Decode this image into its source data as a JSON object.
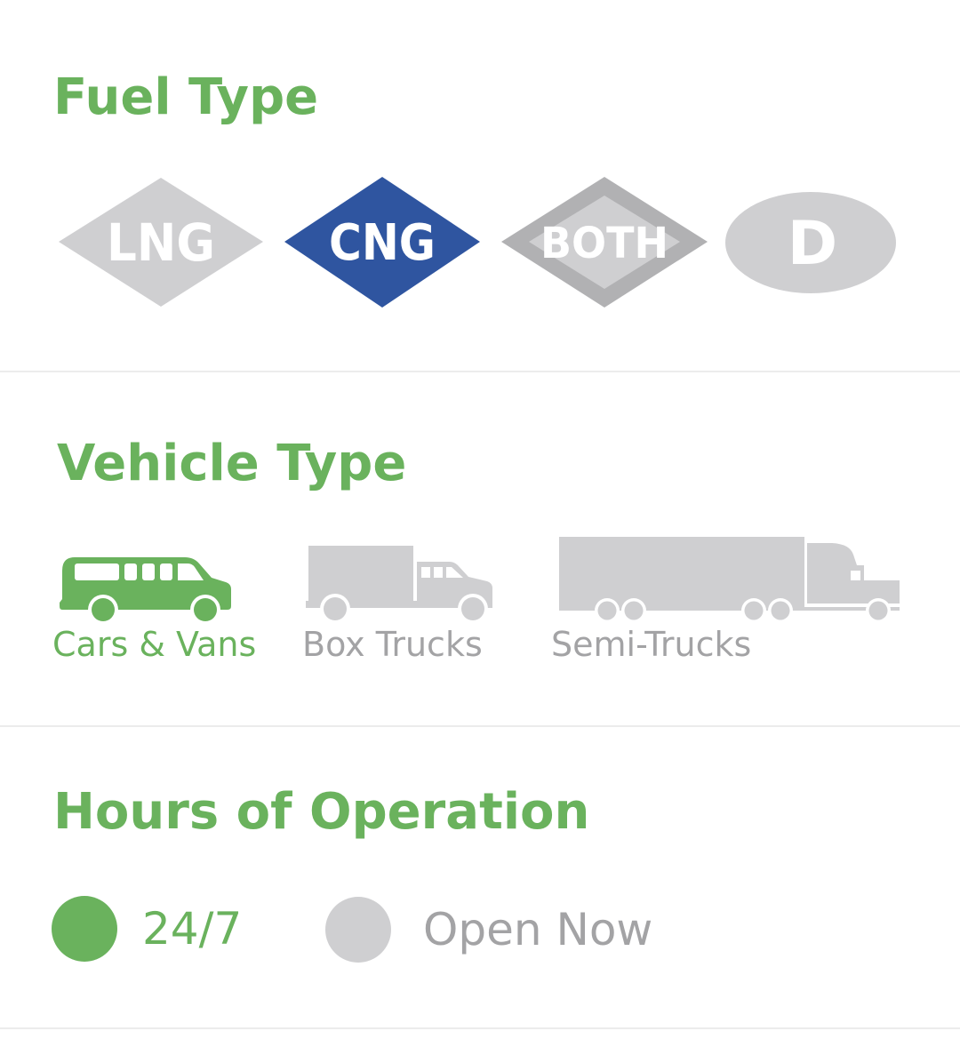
{
  "colors": {
    "accent_green": "#6ab25d",
    "inactive_gray": "#cfcfd1",
    "inactive_text": "#a3a3a5",
    "cng_blue": "#2f55a0",
    "both_border_gray": "#b1b1b3",
    "divider": "#ececec"
  },
  "fuel_type": {
    "title": "Fuel Type",
    "options": [
      {
        "label": "LNG",
        "shape": "diamond",
        "selected": false
      },
      {
        "label": "CNG",
        "shape": "diamond",
        "selected": true
      },
      {
        "label": "BOTH",
        "shape": "double-diamond",
        "selected": false
      },
      {
        "label": "D",
        "shape": "oval",
        "selected": false
      }
    ]
  },
  "vehicle_type": {
    "title": "Vehicle Type",
    "options": [
      {
        "label": "Cars & Vans",
        "icon": "van-icon",
        "selected": true
      },
      {
        "label": "Box Trucks",
        "icon": "box-truck-icon",
        "selected": false
      },
      {
        "label": "Semi-Trucks",
        "icon": "semi-truck-icon",
        "selected": false
      }
    ]
  },
  "hours_of_operation": {
    "title": "Hours of Operation",
    "options": [
      {
        "label": "24/7",
        "selected": true
      },
      {
        "label": "Open Now",
        "selected": false
      }
    ]
  }
}
